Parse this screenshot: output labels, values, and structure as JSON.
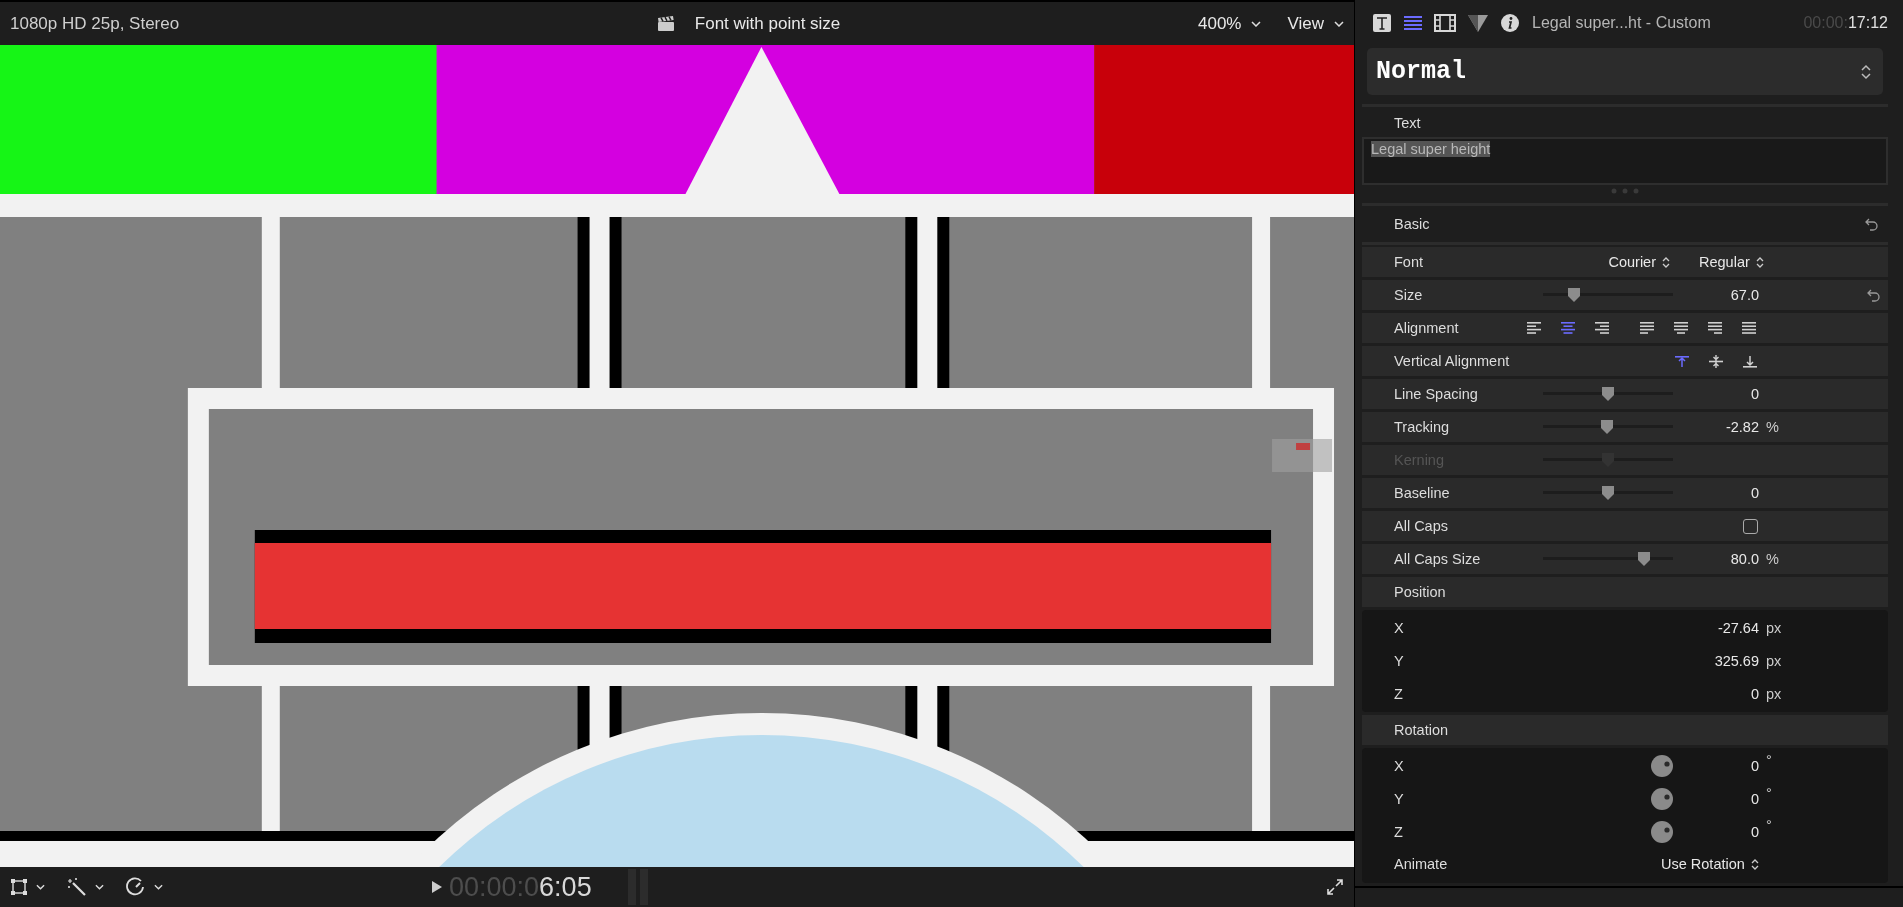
{
  "viewer": {
    "format": "1080p HD 25p, Stereo",
    "title": "Font with point size",
    "zoom": "400%",
    "view_menu": "View"
  },
  "transport": {
    "timecode_dim": "00:00:0",
    "timecode": "6:05"
  },
  "inspector": {
    "tabs": [
      {
        "kind": "title",
        "selected": false
      },
      {
        "kind": "text",
        "selected": true
      },
      {
        "kind": "video",
        "selected": false
      },
      {
        "kind": "color",
        "selected": false
      },
      {
        "kind": "info",
        "selected": false
      }
    ],
    "clip_name": "Legal super...ht - Custom",
    "timecode_dim": "00:00:",
    "timecode": "17:12",
    "preset": "Normal",
    "text_section": {
      "heading": "Text",
      "value": "Legal super height"
    },
    "basic": {
      "heading": "Basic",
      "rows": [
        {
          "kind": "popups",
          "label": "Font",
          "values": [
            "Courier",
            "Regular"
          ]
        },
        {
          "kind": "slider",
          "label": "Size",
          "level": 0.24,
          "value": "67.0",
          "reset": true,
          "disabled": false
        },
        {
          "kind": "segmented",
          "label": "Alignment",
          "options": [
            {
              "kind": "left",
              "selected": false
            },
            {
              "kind": "center",
              "selected": true
            },
            {
              "kind": "right",
              "selected": false
            },
            {
              "kind": "justify-left",
              "selected": false
            },
            {
              "kind": "justify-center",
              "selected": false
            },
            {
              "kind": "justify-right",
              "selected": false
            },
            {
              "kind": "justify-full",
              "selected": false
            }
          ]
        },
        {
          "kind": "segmented",
          "label": "Vertical Alignment",
          "options": [
            {
              "kind": "top",
              "selected": true
            },
            {
              "kind": "middle",
              "selected": false
            },
            {
              "kind": "bottom",
              "selected": false
            }
          ]
        },
        {
          "kind": "slider",
          "label": "Line Spacing",
          "level": 0.5,
          "value": "0",
          "reset": false,
          "disabled": false
        },
        {
          "kind": "slider",
          "label": "Tracking",
          "level": 0.49,
          "value": "-2.82",
          "unit": "%",
          "reset": false,
          "disabled": false
        },
        {
          "kind": "slider",
          "label": "Kerning",
          "level": 0.5,
          "reset": false,
          "disabled": true
        },
        {
          "kind": "slider",
          "label": "Baseline",
          "level": 0.5,
          "value": "0",
          "reset": false,
          "disabled": false
        },
        {
          "kind": "checkbox",
          "label": "All Caps",
          "checked": false
        },
        {
          "kind": "slider",
          "label": "All Caps Size",
          "level": 0.78,
          "value": "80.0",
          "unit": "%",
          "reset": false,
          "disabled": false
        }
      ]
    },
    "position": {
      "heading": "Position",
      "rows": [
        {
          "axis": "X",
          "value": "-27.64",
          "unit": "px"
        },
        {
          "axis": "Y",
          "value": "325.69",
          "unit": "px"
        },
        {
          "axis": "Z",
          "value": "0",
          "unit": "px"
        }
      ]
    },
    "rotation": {
      "heading": "Rotation",
      "rows": [
        {
          "axis": "X",
          "value": "0",
          "unit": "°"
        },
        {
          "axis": "Y",
          "value": "0",
          "unit": "°"
        },
        {
          "axis": "Z",
          "value": "0",
          "unit": "°"
        }
      ],
      "animate": {
        "label": "Animate",
        "value": "Use Rotation"
      }
    }
  }
}
